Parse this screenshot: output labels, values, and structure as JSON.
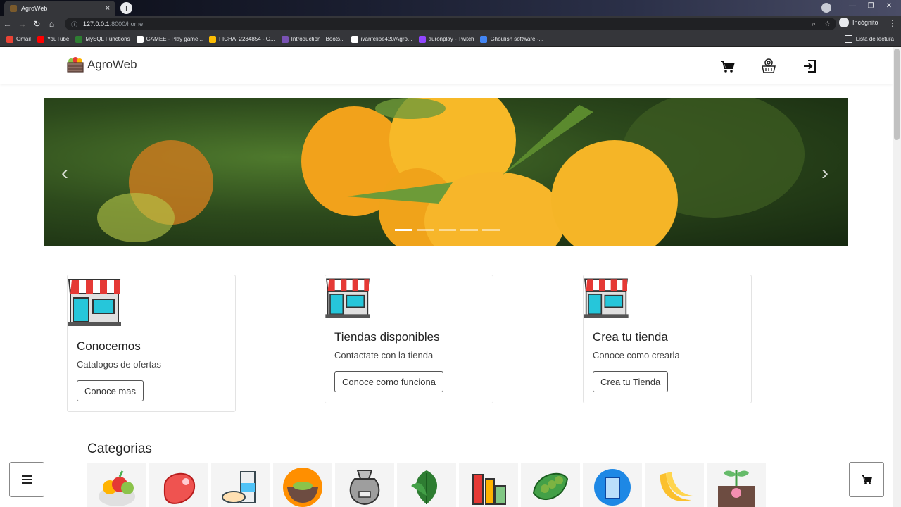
{
  "browser": {
    "tab_title": "AgroWeb",
    "tab_close": "×",
    "new_tab": "+",
    "url_host": "127.0.0.1",
    "url_path": ":8000/home",
    "incognito_label": "Incógnito",
    "bookmarks": [
      {
        "label": "Gmail",
        "color": "#ea4335"
      },
      {
        "label": "YouTube",
        "color": "#ff0000"
      },
      {
        "label": "MySQL Functions",
        "color": "#2e7d32"
      },
      {
        "label": "GAMEE - Play game...",
        "color": "#ffffff"
      },
      {
        "label": "FICHA_2234854 - G...",
        "color": "#fbbc04"
      },
      {
        "label": "Introduction · Boots...",
        "color": "#7952b3"
      },
      {
        "label": "ivanfelipe420/Agro...",
        "color": "#ffffff"
      },
      {
        "label": "auronplay - Twitch",
        "color": "#9146ff"
      },
      {
        "label": "Ghoulish software -...",
        "color": "#4285f4"
      }
    ],
    "reading_list": "Lista de lectura"
  },
  "header": {
    "brand": "AgroWeb",
    "icons": [
      "cart-icon",
      "basket-settings-icon",
      "login-icon"
    ]
  },
  "carousel": {
    "slide_count": 5,
    "active_index": 0,
    "prev": "‹",
    "next": "›"
  },
  "cards": [
    {
      "title": "Conocemos",
      "text": "Catalogos de ofertas",
      "button": "Conoce mas"
    },
    {
      "title": "Tiendas disponibles",
      "text": "Contactate con la tienda",
      "button": "Conoce como funciona"
    },
    {
      "title": "Crea tu tienda",
      "text": "Conoce como crearla",
      "button": "Crea tu Tienda"
    }
  ],
  "categories": {
    "title": "Categorias",
    "icons": [
      "fruits-icon",
      "meat-icon",
      "dairy-cereal-icon",
      "grain-bowl-icon",
      "flour-sack-icon",
      "leaves-icon",
      "beverages-icon",
      "peas-icon",
      "coffee-can-icon",
      "banana-icon",
      "sprout-icon"
    ]
  },
  "colors": {
    "accent_red": "#e53935",
    "store_teal": "#26c6da",
    "dark": "#333333"
  }
}
